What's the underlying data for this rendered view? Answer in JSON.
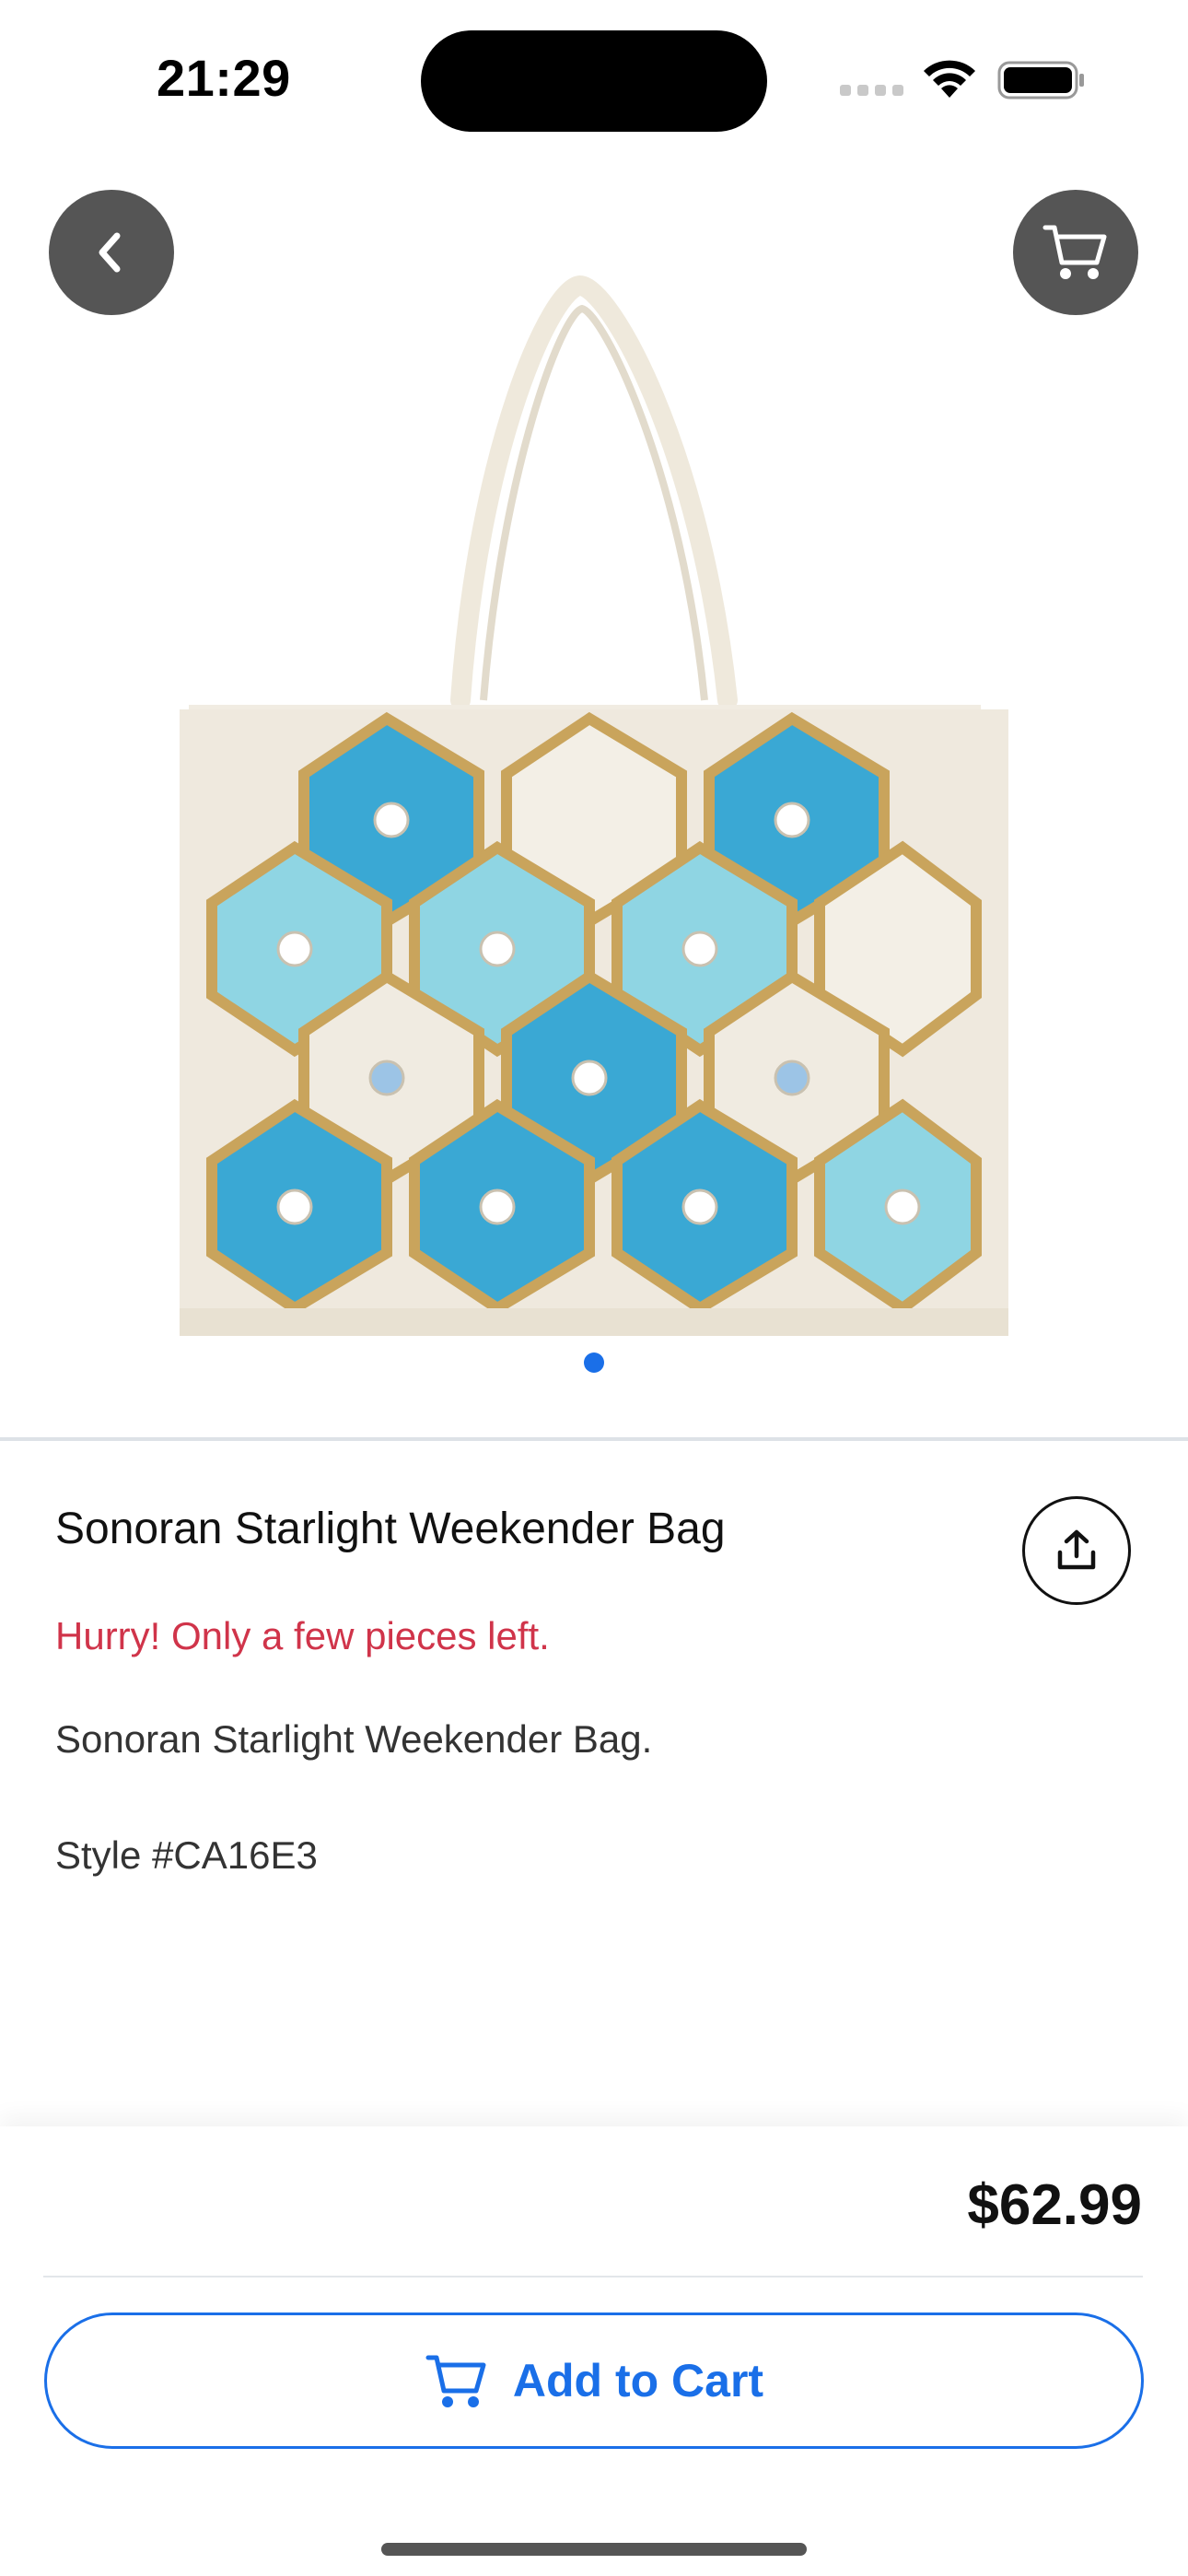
{
  "status_bar": {
    "time": "21:29"
  },
  "header": {
    "back_icon": "chevron-left-icon",
    "cart_icon": "cart-icon"
  },
  "product": {
    "title": "Sonoran Starlight Weekender Bag",
    "stock_warning": "Hurry! Only a few pieces left.",
    "description": "Sonoran Starlight Weekender Bag.",
    "style": "Style #CA16E3",
    "price": "$62.99",
    "image_count": 1,
    "current_image": 1
  },
  "actions": {
    "share_icon": "share-icon",
    "add_to_cart_label": "Add to Cart",
    "add_to_cart_icon": "cart-icon"
  },
  "colors": {
    "accent": "#1a6fe8",
    "warning": "#d0344a",
    "header_button": "#555555"
  }
}
